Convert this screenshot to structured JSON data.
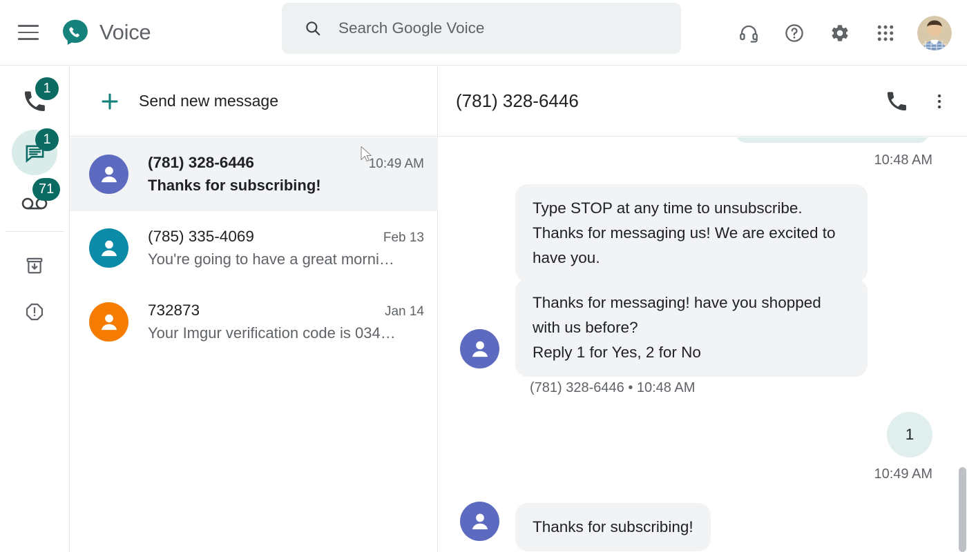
{
  "app": {
    "brand_name": "Voice",
    "logo_icon": "google-voice-logo",
    "menu_icon": "hamburger-menu-icon",
    "accent_color": "#0b6b62",
    "selected_row_color": "#f1f3f4",
    "incoming_bubble_color": "#f1f3f4",
    "outgoing_bubble_color": "#e0efee"
  },
  "search": {
    "placeholder": "Search Google Voice",
    "icon": "search-icon",
    "value": ""
  },
  "header_actions": [
    {
      "name": "support-headset-icon",
      "label": "Support"
    },
    {
      "name": "help-icon",
      "label": "Help"
    },
    {
      "name": "settings-gear-icon",
      "label": "Settings"
    },
    {
      "name": "apps-grid-icon",
      "label": "Google apps"
    }
  ],
  "account": {
    "avatar": "user-profile-photo"
  },
  "sidebar": {
    "items": [
      {
        "name": "calls",
        "icon": "phone-icon",
        "badge": "1",
        "active": false
      },
      {
        "name": "messages",
        "icon": "message-bubble-icon",
        "badge": "1",
        "active": true
      },
      {
        "name": "voicemail",
        "icon": "voicemail-icon",
        "badge": "71",
        "active": false
      },
      {
        "name": "archive",
        "icon": "archive-icon",
        "badge": "",
        "active": false
      },
      {
        "name": "spam",
        "icon": "spam-warning-icon",
        "badge": "",
        "active": false
      }
    ]
  },
  "list": {
    "new_message_label": "Send new message",
    "new_message_icon": "plus-icon",
    "conversations": [
      {
        "name": "(781) 328-6446",
        "snippet": "Thanks for subscribing!",
        "time": "10:49 AM",
        "avatar_color": "#5c6bc0",
        "selected": true,
        "unread": true
      },
      {
        "name": "(785) 335-4069",
        "snippet": "You're going to have a great morni…",
        "time": "Feb 13",
        "avatar_color": "#0b8ba8",
        "selected": false,
        "unread": false
      },
      {
        "name": "732873",
        "snippet": "Your Imgur verification code is 034…",
        "time": "Jan 14",
        "avatar_color": "#f57c00",
        "selected": false,
        "unread": false
      }
    ]
  },
  "thread": {
    "title": "(781) 328-6446",
    "call_icon": "phone-call-icon",
    "more_icon": "more-vertical-icon",
    "timestamp_top": "10:48 AM",
    "messages": [
      {
        "direction": "incoming",
        "text": "Type STOP at any time to unsubscribe.\nThanks for messaging us! We are excited to\nhave you.",
        "avatar_color": "#5c6bc0"
      },
      {
        "direction": "incoming",
        "text": "Thanks for messaging! have you shopped\nwith us before?\nReply 1 for Yes, 2 for No",
        "avatar_color": "#5c6bc0",
        "meta": "(781) 328-6446 • 10:48 AM"
      },
      {
        "direction": "outgoing",
        "text": "1",
        "meta": "10:49 AM"
      },
      {
        "direction": "incoming",
        "text": "Thanks for subscribing!",
        "avatar_color": "#5c6bc0"
      }
    ]
  }
}
